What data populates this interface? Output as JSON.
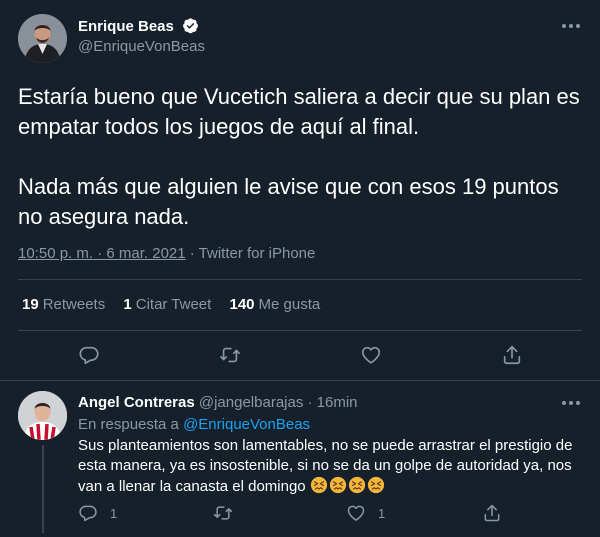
{
  "tweet": {
    "author_name": "Enrique Beas",
    "author_handle": "@EnriqueVonBeas",
    "paragraph_1": "Estaría bueno que Vucetich saliera a decir que su plan es empatar todos los juegos de aquí al final.",
    "paragraph_2": "Nada más que alguien le avise que con esos 19 puntos no asegura nada.",
    "timestamp": "10:50 p. m. · 6 mar. 2021",
    "source": " · Twitter for iPhone",
    "stats": {
      "retweets_count": "19",
      "retweets_label": "Retweets",
      "quotes_count": "1",
      "quotes_label": "Citar Tweet",
      "likes_count": "140",
      "likes_label": "Me gusta"
    }
  },
  "reply": {
    "author_name": "Angel Contreras",
    "author_handle": "@jangelbarajas",
    "time": " · 16min",
    "replying_prefix": "En respuesta a ",
    "replying_to": "@EnriqueVonBeas",
    "text": "Sus planteamientos son lamentables, no se puede arrastrar el prestigio de esta manera, ya es insostenible, si no se da un golpe de autoridad ya, nos van a llenar la canasta el domingo ",
    "emoji_count": 4,
    "reply_count": "1",
    "like_count": "1"
  },
  "colors": {
    "background": "#15202b",
    "text_secondary": "#8899a6",
    "link": "#1da1f2",
    "divider": "#38444d"
  },
  "icons": [
    "verified-badge-icon",
    "more-icon",
    "reply-icon",
    "retweet-icon",
    "like-icon",
    "share-icon",
    "confounded-face-emoji"
  ]
}
